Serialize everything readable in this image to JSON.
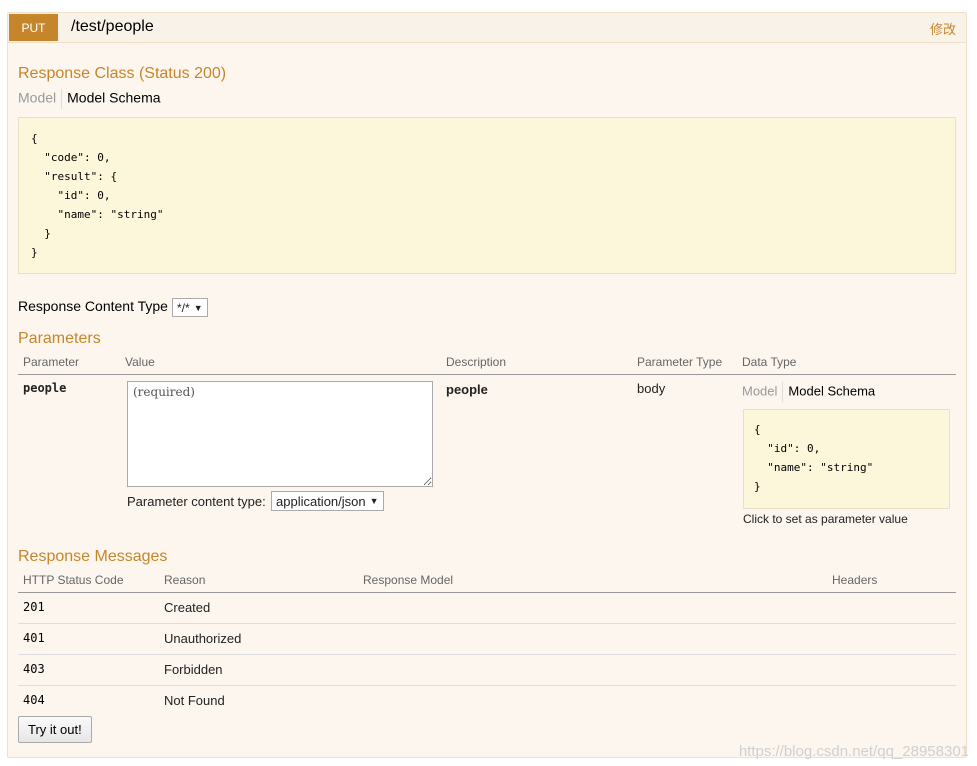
{
  "operation": {
    "method": "PUT",
    "path": "/test/people",
    "edit_link": "修改"
  },
  "response_class": {
    "title": "Response Class (Status 200)",
    "tabs": [
      "Model",
      "Model Schema"
    ],
    "schema": "{\n  \"code\": 0,\n  \"result\": {\n    \"id\": 0,\n    \"name\": \"string\"\n  }\n}"
  },
  "response_content_type": {
    "label": "Response Content Type",
    "selected": "*/*"
  },
  "parameters": {
    "title": "Parameters",
    "headers": [
      "Parameter",
      "Value",
      "Description",
      "Parameter Type",
      "Data Type"
    ],
    "rows": [
      {
        "name": "people",
        "placeholder": "(required)",
        "description": "people",
        "param_type": "body",
        "content_type_label": "Parameter content type:",
        "content_type_selected": "application/json",
        "data_type_tabs": [
          "Model",
          "Model Schema"
        ],
        "schema": "{\n  \"id\": 0,\n  \"name\": \"string\"\n}",
        "schema_hint": "Click to set as parameter value"
      }
    ]
  },
  "response_messages": {
    "title": "Response Messages",
    "headers": [
      "HTTP Status Code",
      "Reason",
      "Response Model",
      "Headers"
    ],
    "rows": [
      {
        "code": "201",
        "reason": "Created"
      },
      {
        "code": "401",
        "reason": "Unauthorized"
      },
      {
        "code": "403",
        "reason": "Forbidden"
      },
      {
        "code": "404",
        "reason": "Not Found"
      }
    ]
  },
  "try_button": "Try it out!",
  "watermark": "https://blog.csdn.net/qq_28958301",
  "colors": {
    "accent": "#c5862b",
    "panel_bg": "#fcf6ef",
    "snippet_bg": "#fcf6db"
  }
}
